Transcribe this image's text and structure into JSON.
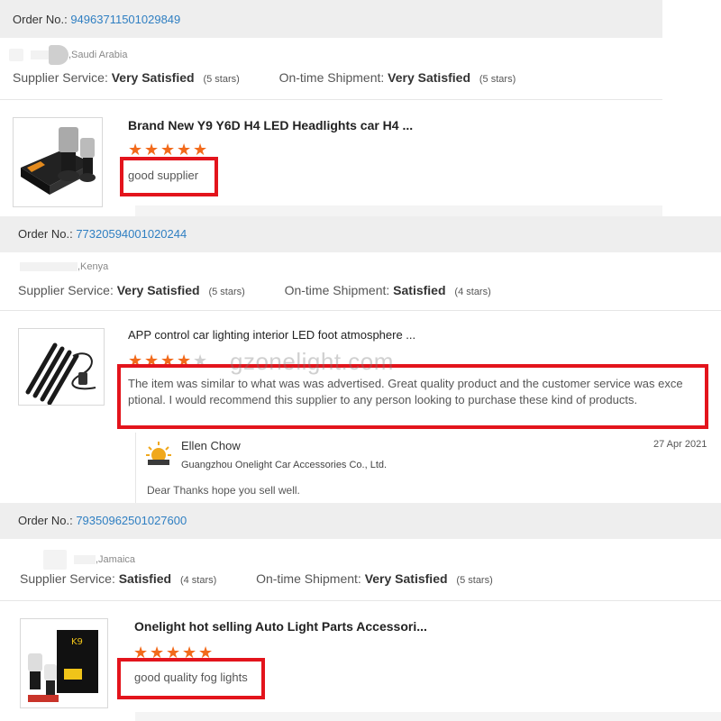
{
  "orders": [
    {
      "order_label": "Order No.:",
      "order_number": "94963711501029849",
      "buyer_country": ",Saudi Arabia",
      "supplier_service_label": "Supplier Service:",
      "supplier_service_value": "Very Satisfied",
      "supplier_service_stars": "(5 stars)",
      "shipment_label": "On-time Shipment:",
      "shipment_value": "Very Satisfied",
      "shipment_stars": "(5 stars)",
      "product_title": "Brand New Y9 Y6D H4 LED Headlights car H4 ...",
      "rating": 5,
      "review": "good supplier"
    },
    {
      "order_label": "Order No.:",
      "order_number": "77320594001020244",
      "buyer_country": ",Kenya",
      "supplier_service_label": "Supplier Service:",
      "supplier_service_value": "Very Satisfied",
      "supplier_service_stars": "(5 stars)",
      "shipment_label": "On-time Shipment:",
      "shipment_value": "Satisfied",
      "shipment_stars": "(4 stars)",
      "product_title": "APP control car lighting interior LED foot atmosphere ...",
      "rating": 4,
      "review_line1": "The item was similar to what was was advertised. Great quality product and the customer service was exce",
      "review_line2": "ptional. I would recommend this supplier to any person looking to purchase these kind of products.",
      "reply": {
        "seller_name": "Ellen Chow",
        "company": "Guangzhou Onelight Car Accessories Co., Ltd.",
        "date": "27 Apr 2021",
        "text": "Dear Thanks hope you sell well."
      }
    },
    {
      "order_label": "Order No.:",
      "order_number": "79350962501027600",
      "buyer_country": ",Jamaica",
      "supplier_service_label": "Supplier Service:",
      "supplier_service_value": "Satisfied",
      "supplier_service_stars": "(4 stars)",
      "shipment_label": "On-time Shipment:",
      "shipment_value": "Very Satisfied",
      "shipment_stars": "(5 stars)",
      "product_title": "Onelight hot selling Auto Light Parts Accessori...",
      "rating": 5,
      "review": "good quality fog lights"
    }
  ],
  "watermark": "gzonelight.com",
  "colors": {
    "accent_link": "#2f7fc2",
    "star": "#f26a1b",
    "highlight_box": "#e3141c"
  }
}
